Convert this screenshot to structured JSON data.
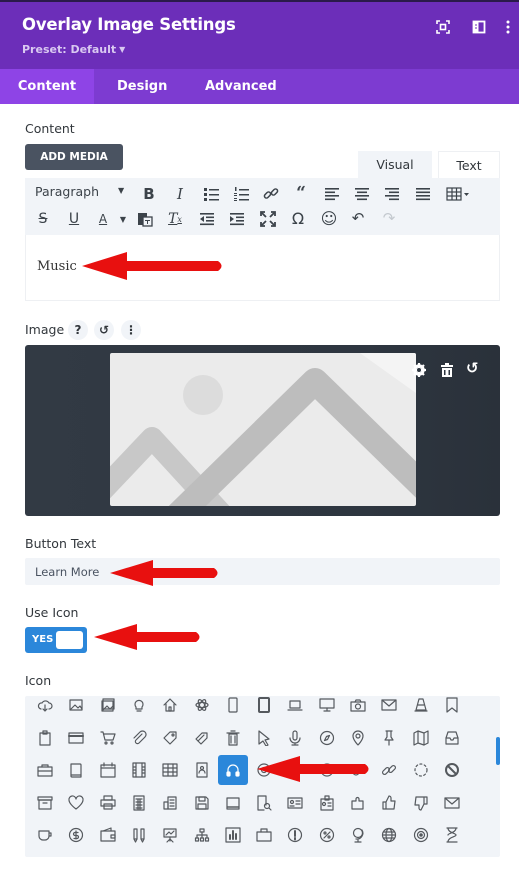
{
  "header": {
    "title": "Overlay Image Settings",
    "preset": "Preset: Default",
    "icons": [
      "focus-mode-icon",
      "split-view-icon",
      "more-options-icon"
    ]
  },
  "tabs": [
    {
      "label": "Content",
      "active": true
    },
    {
      "label": "Design",
      "active": false
    },
    {
      "label": "Advanced",
      "active": false
    }
  ],
  "content": {
    "label": "Content",
    "add_media": "ADD MEDIA",
    "editor_tabs": [
      "Visual",
      "Text"
    ],
    "format_select": "Paragraph",
    "toolbar_row1": [
      "bold",
      "italic",
      "bulleted-list",
      "numbered-list",
      "link",
      "blockquote",
      "align-left",
      "align-center",
      "align-right",
      "justify",
      "table"
    ],
    "toolbar_row2": [
      "strikethrough",
      "underline",
      "text-color",
      "paste-as-text",
      "clear-formatting",
      "outdent",
      "indent",
      "fullscreen",
      "special-character",
      "emoji",
      "undo",
      "redo"
    ],
    "value": "Music"
  },
  "image": {
    "label": "Image",
    "tools": [
      "settings",
      "delete",
      "reset"
    ]
  },
  "button_text": {
    "label": "Button Text",
    "value": "Learn More"
  },
  "use_icon": {
    "label": "Use Icon",
    "value": "YES",
    "on": true
  },
  "icon": {
    "label": "Icon",
    "selected": "headphones",
    "grid": [
      [
        "cloud-download",
        "image",
        "images",
        "lightbulb",
        "home",
        "atom",
        "mobile",
        "tablet",
        "laptop",
        "desktop",
        "camera",
        "envelope",
        "cone",
        "bookmark"
      ],
      [
        "clipboard",
        "credit-card",
        "cart",
        "paperclip",
        "tag",
        "tags",
        "trash",
        "cursor",
        "microphone",
        "compass",
        "map-pin",
        "pushpin",
        "map",
        "inbox"
      ],
      [
        "toolbox",
        "book",
        "calendar",
        "film",
        "table",
        "address-book",
        "headphones",
        "lifebuoy",
        "chat",
        "clock",
        "link-chain",
        "chain",
        "spinner",
        "ban"
      ],
      [
        "archive",
        "heart",
        "printer",
        "calculator",
        "building",
        "floppy-disk",
        "drive",
        "search-document",
        "id-card",
        "badge",
        "puzzle",
        "thumbs-up",
        "thumbs-down",
        "mail"
      ],
      [
        "cup",
        "dollar",
        "wallet",
        "pens",
        "presentation",
        "sitemap",
        "bar-chart",
        "briefcase",
        "exclamation",
        "percent",
        "globe-stand",
        "globe",
        "target",
        "hourglass"
      ]
    ]
  }
}
